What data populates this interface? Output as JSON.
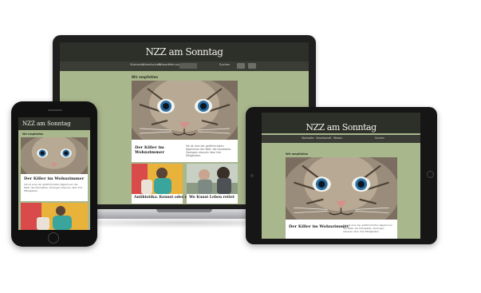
{
  "site": {
    "logo": "NZZ am Sonntag",
    "nav": [
      "Startseite",
      "Gesellschaft",
      "Wissen",
      "Meinungen",
      "Suchen"
    ],
    "section": "Wir empfehlen"
  },
  "lead_article": {
    "title": "Der Killer im Wohnzimmer",
    "teaser": "Sie ist eine der gefährlichsten Jägerinnen der Welt: die Hauskatze. Zoologen staunen über ihre Fähigkeiten."
  },
  "articles": [
    {
      "title": "Antibiotika: Kennst oder nicht"
    },
    {
      "title": "Wo Kunst Leben rettet"
    }
  ],
  "colors": {
    "page_bg": "#a9b78d",
    "header_bg": "#2d2f29",
    "accent_teal": "#3aa59c"
  }
}
